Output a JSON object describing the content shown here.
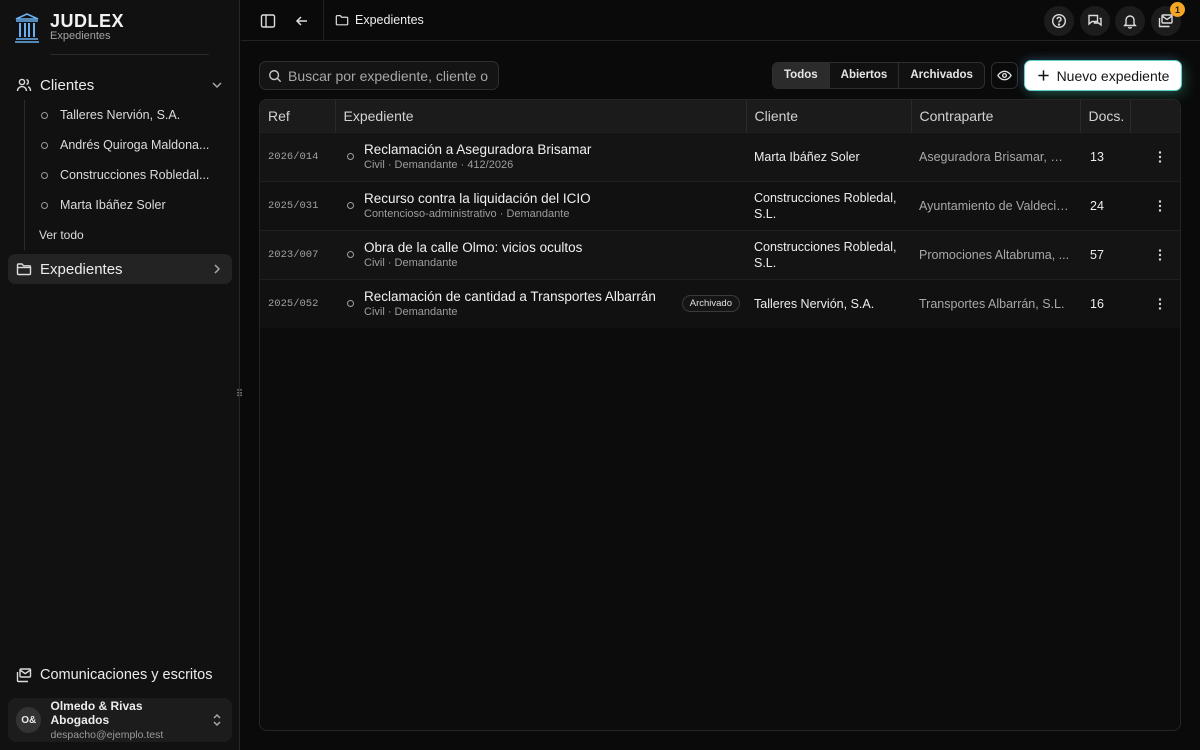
{
  "brand": {
    "name": "JUDLEX",
    "section": "Expedientes"
  },
  "sidebar": {
    "clientes": {
      "label": "Clientes",
      "items": [
        {
          "label": "Talleres Nervión, S.A."
        },
        {
          "label": "Andrés Quiroga Maldona..."
        },
        {
          "label": "Construcciones Robledal..."
        },
        {
          "label": "Marta Ibáñez Soler"
        }
      ],
      "see_all": "Ver todo"
    },
    "expedientes": {
      "label": "Expedientes"
    },
    "comunicaciones": {
      "label": "Comunicaciones y escritos"
    },
    "account": {
      "initials": "O&",
      "name": "Olmedo & Rivas Abogados",
      "email": "despacho@ejemplo.test"
    }
  },
  "topbar": {
    "breadcrumb": "Expedientes",
    "notifications_badge": "1"
  },
  "toolbar": {
    "search_placeholder": "Buscar por expediente, cliente o",
    "filters": [
      "Todos",
      "Abiertos",
      "Archivados"
    ],
    "selected_filter": "Todos",
    "new_button": "Nuevo expediente"
  },
  "table": {
    "columns": [
      "Ref",
      "Expediente",
      "Cliente",
      "Contraparte",
      "Docs."
    ],
    "rows": [
      {
        "ref": "2026/014",
        "title": "Reclamación a Aseguradora Brisamar",
        "meta": "Civil · Demandante · 412/2026",
        "badge": "",
        "client": "Marta Ibáñez Soler",
        "counterparty": "Aseguradora Brisamar, S.A.",
        "docs": "13"
      },
      {
        "ref": "2025/031",
        "title": "Recurso contra la liquidación del ICIO",
        "meta": "Contencioso-administrativo · Demandante",
        "badge": "",
        "client": "Construcciones Robledal, S.L.",
        "counterparty": "Ayuntamiento de Valdecie...",
        "docs": "24"
      },
      {
        "ref": "2023/007",
        "title": "Obra de la calle Olmo: vicios ocultos",
        "meta": "Civil · Demandante",
        "badge": "",
        "client": "Construcciones Robledal, S.L.",
        "counterparty": "Promociones Altabruma, ...",
        "docs": "57"
      },
      {
        "ref": "2025/052",
        "title": "Reclamación de cantidad a Transportes Albarrán",
        "meta": "Civil · Demandante",
        "badge": "Archivado",
        "client": "Talleres Nervión, S.A.",
        "counterparty": "Transportes Albarrán, S.L.",
        "docs": "16"
      }
    ]
  }
}
